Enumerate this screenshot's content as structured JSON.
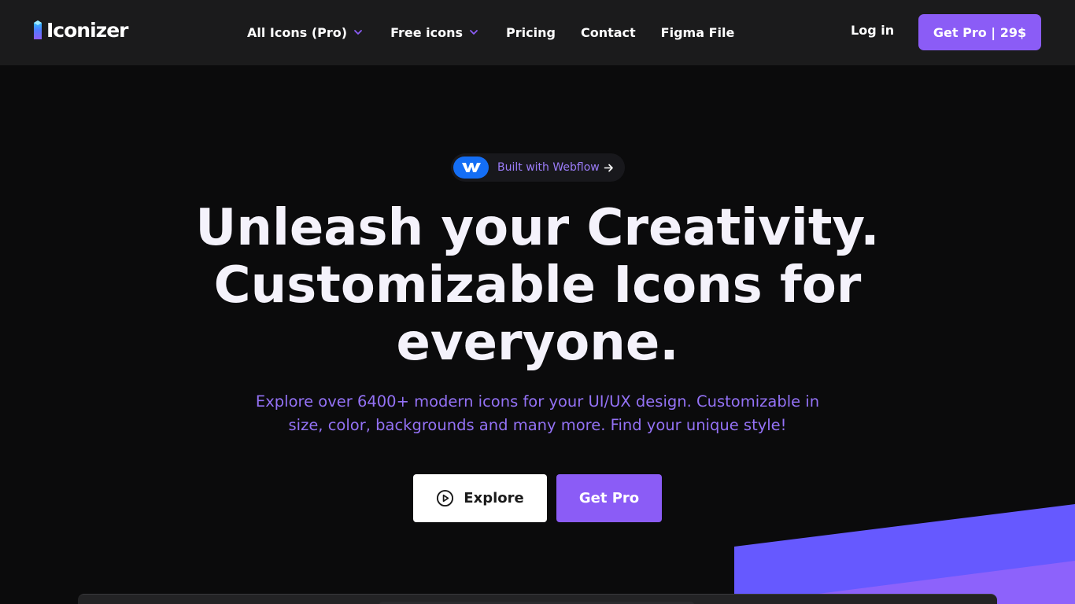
{
  "brand": {
    "name": "Iconizer"
  },
  "nav": {
    "items": [
      {
        "label": "All Icons (Pro)",
        "dropdown": true
      },
      {
        "label": "Free icons",
        "dropdown": true
      },
      {
        "label": "Pricing",
        "dropdown": false
      },
      {
        "label": "Contact",
        "dropdown": false
      },
      {
        "label": "Figma File",
        "dropdown": false
      }
    ],
    "login_label": "Log in",
    "cta_label": "Get Pro | 29$"
  },
  "badge": {
    "label": "Built with Webflow",
    "icon": "webflow-logo-icon",
    "arrow_icon": "arrow-right-icon"
  },
  "hero": {
    "title_lines": [
      "Unleash your Creativity.",
      "Customizable Icons for",
      "everyone."
    ],
    "subtitle_lines": [
      "Explore over 6400+ modern icons for your UI/UX design. Customizable in",
      "size, color, backgrounds and many more. Find your unique style!"
    ],
    "explore_label": "Explore",
    "explore_icon": "play-circle-icon",
    "getpro_label": "Get Pro"
  },
  "colors": {
    "accent": "#8b5cf6",
    "nav_bg": "#1b1b1c",
    "page_bg": "#0b0b0c",
    "decor_blue": "#6659ff",
    "decor_violet": "#8d62fb",
    "webflow_blue": "#146ef5"
  }
}
